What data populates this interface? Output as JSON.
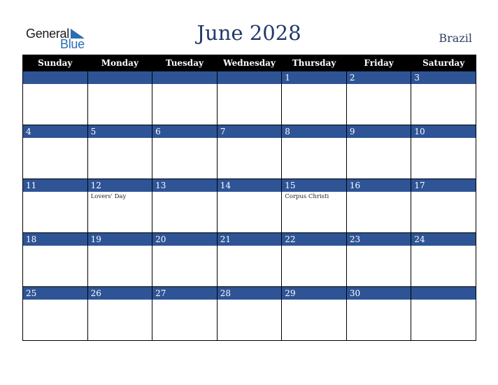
{
  "brand": {
    "line1": "General",
    "line2": "Blue",
    "accent_color": "#2a6db3"
  },
  "header": {
    "title": "June 2028",
    "country": "Brazil"
  },
  "colors": {
    "header_bg": "#000000",
    "daybar_bg": "#2e5496",
    "title": "#22396b"
  },
  "weekdays": [
    "Sunday",
    "Monday",
    "Tuesday",
    "Wednesday",
    "Thursday",
    "Friday",
    "Saturday"
  ],
  "weeks": [
    [
      {
        "day": "",
        "holiday": ""
      },
      {
        "day": "",
        "holiday": ""
      },
      {
        "day": "",
        "holiday": ""
      },
      {
        "day": "",
        "holiday": ""
      },
      {
        "day": "1",
        "holiday": ""
      },
      {
        "day": "2",
        "holiday": ""
      },
      {
        "day": "3",
        "holiday": ""
      }
    ],
    [
      {
        "day": "4",
        "holiday": ""
      },
      {
        "day": "5",
        "holiday": ""
      },
      {
        "day": "6",
        "holiday": ""
      },
      {
        "day": "7",
        "holiday": ""
      },
      {
        "day": "8",
        "holiday": ""
      },
      {
        "day": "9",
        "holiday": ""
      },
      {
        "day": "10",
        "holiday": ""
      }
    ],
    [
      {
        "day": "11",
        "holiday": ""
      },
      {
        "day": "12",
        "holiday": "Lovers' Day"
      },
      {
        "day": "13",
        "holiday": ""
      },
      {
        "day": "14",
        "holiday": ""
      },
      {
        "day": "15",
        "holiday": "Corpus Christi"
      },
      {
        "day": "16",
        "holiday": ""
      },
      {
        "day": "17",
        "holiday": ""
      }
    ],
    [
      {
        "day": "18",
        "holiday": ""
      },
      {
        "day": "19",
        "holiday": ""
      },
      {
        "day": "20",
        "holiday": ""
      },
      {
        "day": "21",
        "holiday": ""
      },
      {
        "day": "22",
        "holiday": ""
      },
      {
        "day": "23",
        "holiday": ""
      },
      {
        "day": "24",
        "holiday": ""
      }
    ],
    [
      {
        "day": "25",
        "holiday": ""
      },
      {
        "day": "26",
        "holiday": ""
      },
      {
        "day": "27",
        "holiday": ""
      },
      {
        "day": "28",
        "holiday": ""
      },
      {
        "day": "29",
        "holiday": ""
      },
      {
        "day": "30",
        "holiday": ""
      },
      {
        "day": "",
        "holiday": ""
      }
    ]
  ]
}
